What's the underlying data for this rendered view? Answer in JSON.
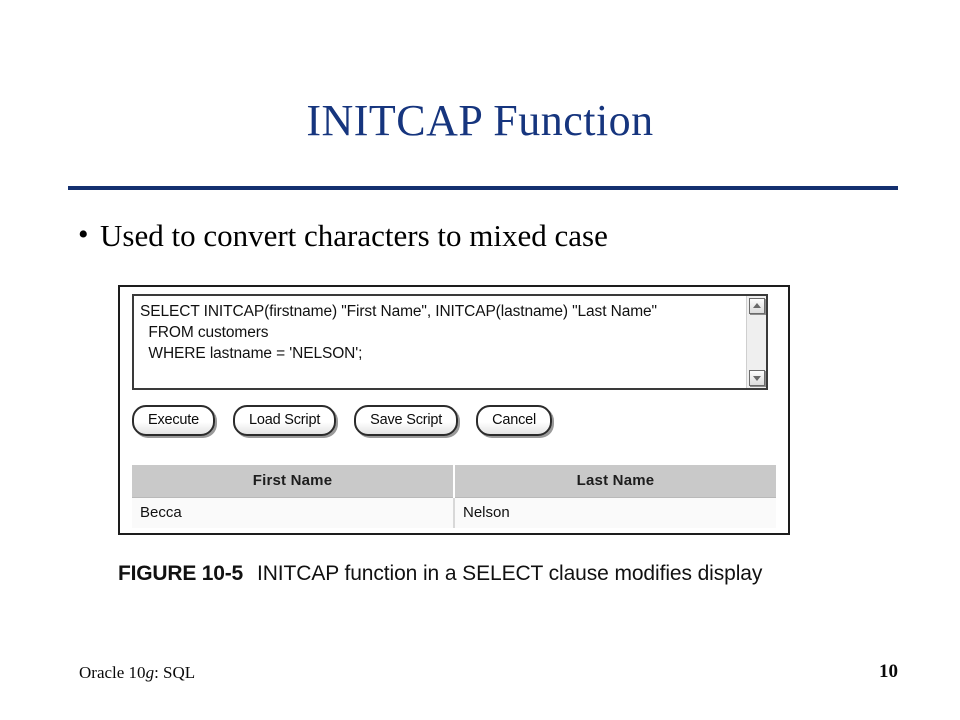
{
  "slide": {
    "title": "INITCAP Function",
    "bullet_marker": "•",
    "bullet_text": "Used to convert characters to mixed case",
    "rule_color": "#14306f",
    "title_color": "#16357e"
  },
  "figure": {
    "sql_editor": {
      "value": "SELECT INITCAP(firstname) \"First Name\", INITCAP(lastname) \"Last Name\"\n  FROM customers\n  WHERE lastname = 'NELSON';",
      "line_1": "SELECT INITCAP(firstname) \"First Name\", INITCAP(lastname) \"Last Name\"",
      "line_2": "  FROM customers",
      "line_3": "  WHERE lastname = 'NELSON';",
      "scrollbar": {
        "up_icon": "scroll-up-icon",
        "down_icon": "scroll-down-icon"
      }
    },
    "buttons": [
      {
        "label": "Execute"
      },
      {
        "label": "Load Script"
      },
      {
        "label": "Save Script"
      },
      {
        "label": "Cancel"
      }
    ],
    "results": {
      "columns": [
        "First Name",
        "Last Name"
      ],
      "rows": [
        [
          "Becca",
          "Nelson"
        ]
      ]
    },
    "caption": {
      "label": "FIGURE 10-5",
      "text": "INITCAP function in a SELECT clause modifies display"
    },
    "header_bg": "#c9c9c9",
    "panel_border": "#1d1d1d"
  },
  "footer": {
    "book_prefix": "Oracle 10",
    "book_italic": "g",
    "book_suffix": ": SQL",
    "page_number": "10"
  }
}
